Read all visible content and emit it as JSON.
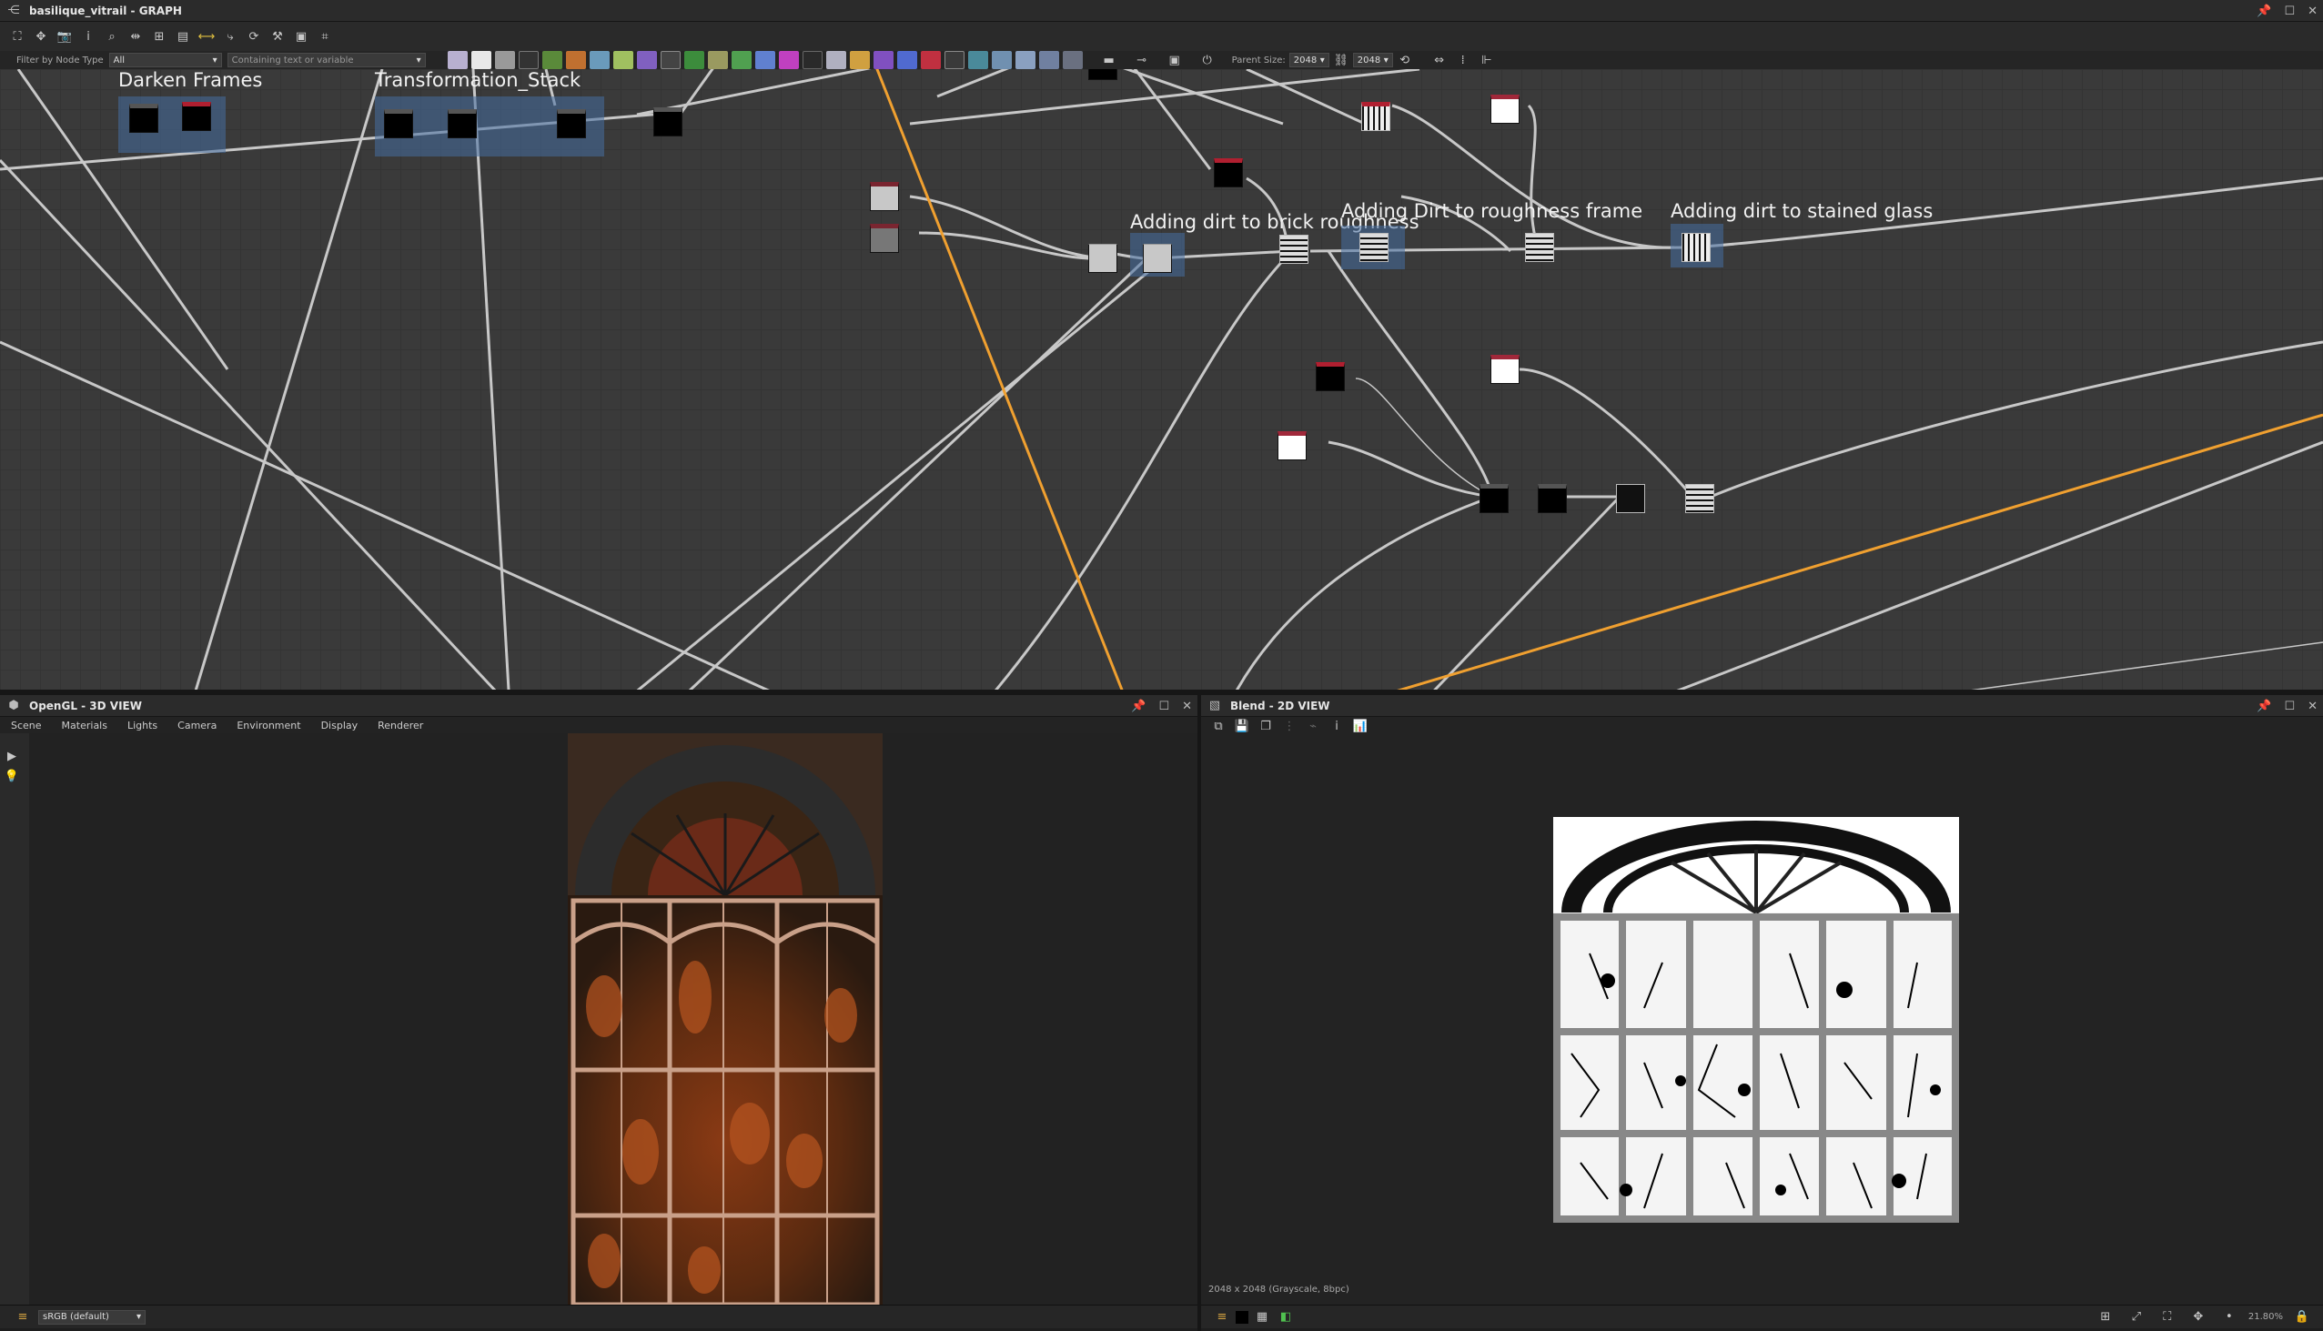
{
  "graph_panel": {
    "title": "basilique_vitrail - GRAPH",
    "filter_label": "Filter by Node Type",
    "filter_value": "All",
    "search_placeholder": "Containing text or variable",
    "parent_size_label": "Parent Size:",
    "parent_size_value": "2048",
    "output_size_value": "2048"
  },
  "frames": [
    {
      "label": "Darken Frames"
    },
    {
      "label": "Transformation_Stack"
    },
    {
      "label": "Adding dirt to brick roughness"
    },
    {
      "label": "Adding Dirt to roughness frame"
    },
    {
      "label": "Adding dirt to stained glass"
    }
  ],
  "view3d": {
    "title": "OpenGL - 3D VIEW",
    "menus": [
      "Scene",
      "Materials",
      "Lights",
      "Camera",
      "Environment",
      "Display",
      "Renderer"
    ],
    "colorspace": "sRGB (default)"
  },
  "view2d": {
    "title": "Blend - 2D VIEW",
    "info": "2048 x 2048 (Grayscale, 8bpc)",
    "zoom": "21.80%"
  },
  "colors": {
    "accent_wire": "#f0a030",
    "wire": "#c8c8c8",
    "frame": "#466ea0"
  }
}
